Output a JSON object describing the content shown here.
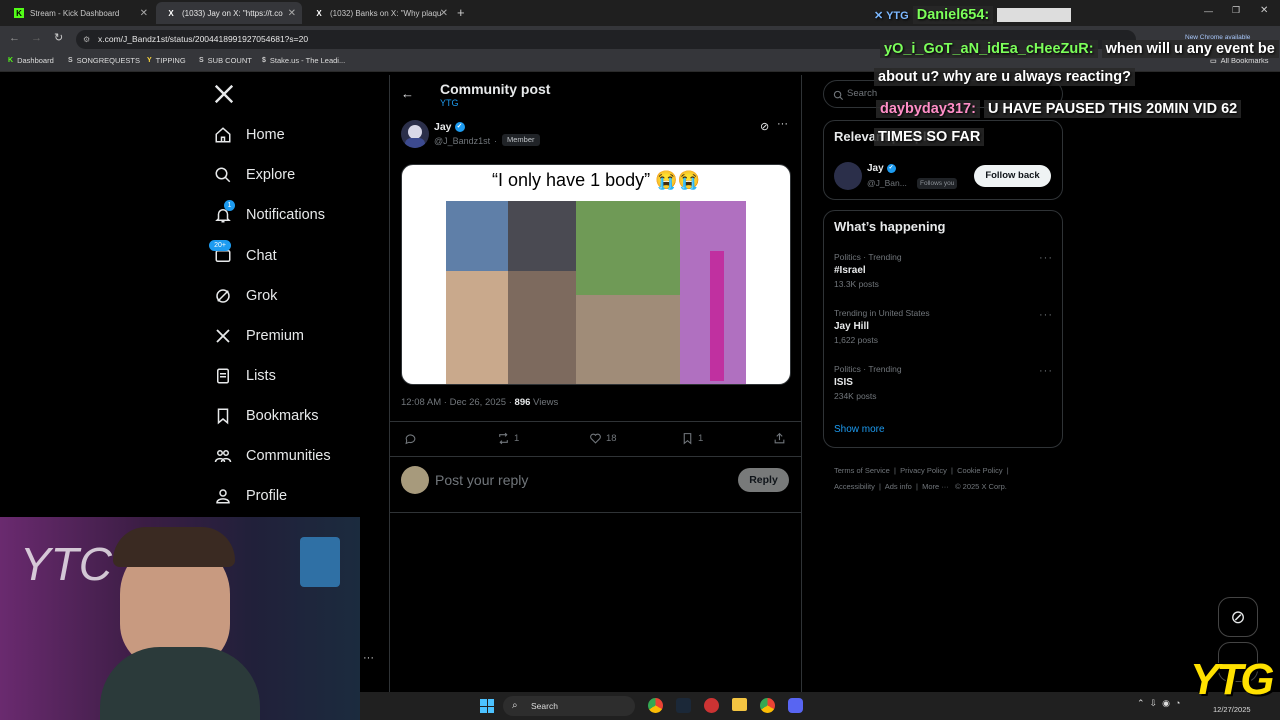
{
  "browser": {
    "tabs": [
      {
        "label": "Stream - Kick Dashboard"
      },
      {
        "label": "(1033) Jay on X: \"https://t.co"
      },
      {
        "label": "(1032) Banks on X: \"Why plaqu"
      }
    ],
    "url": "x.com/J_Bandz1st/status/2004418991927054681?s=20",
    "new_chrome": "New Chrome available",
    "bookmarks": [
      "Dashboard",
      "SONGREQUESTS",
      "TIPPING",
      "SUB COUNT",
      "Stake.us - The Leadi..."
    ],
    "all_bookmarks": "All Bookmarks"
  },
  "nav": {
    "items": [
      "Home",
      "Explore",
      "Notifications",
      "Chat",
      "Grok",
      "Premium",
      "Lists",
      "Bookmarks",
      "Communities",
      "Profile"
    ],
    "notif_badge": "1",
    "chat_badge": "20+"
  },
  "header": {
    "title": "Community post",
    "subtitle": "YTG"
  },
  "post": {
    "author": "Jay",
    "handle": "@J_Bandz1st",
    "member_badge": "Member",
    "image_caption": "“I only have 1 body” 😭😭",
    "time": "12:08 AM · Dec 26, 2025 · ",
    "views_count": "896",
    "views_label": " Views",
    "reposts": "1",
    "likes": "18",
    "bookmarks": "1"
  },
  "reply": {
    "placeholder": "Post your reply",
    "button": "Reply"
  },
  "right": {
    "search_placeholder": "Search",
    "relevant_title": "Relevant people",
    "person_name": "Jay",
    "person_handle": "@J_Ban...",
    "follows_you": "Follows you",
    "follow_back": "Follow back",
    "happening_title": "What’s happening",
    "trends": [
      {
        "meta": "Politics · Trending",
        "name": "#Israel",
        "posts": "13.3K posts"
      },
      {
        "meta": "Trending in United States",
        "name": "Jay Hill",
        "posts": "1,622 posts"
      },
      {
        "meta": "Politics · Trending",
        "name": "ISIS",
        "posts": "234K posts"
      }
    ],
    "show_more": "Show more",
    "footer": [
      "Terms of Service",
      "Privacy Policy",
      "Cookie Policy",
      "Accessibility",
      "Ads info",
      "More ···",
      "© 2025 X Corp."
    ]
  },
  "chat": [
    {
      "user": "Daniel654:",
      "message": "",
      "user_color": "#7cff5a"
    },
    {
      "user": "yO_i_GoT_aN_idEa_cHeeZuR:",
      "message": "when will u any event be",
      "user_color": "#7cff5a"
    },
    {
      "user": "",
      "message": "about u? why are u always reacting?",
      "user_color": "#7cff5a"
    },
    {
      "user": "daybyday317:",
      "message": "U HAVE PAUSED THIS 20MIN VID 62",
      "user_color": "#ff8ec7"
    },
    {
      "user": "",
      "message": "TIMES SO FAR",
      "user_color": "#ff8ec7"
    }
  ],
  "taskbar": {
    "search": "Search",
    "date": "12/27/2025"
  },
  "overlay_logo": "YTG"
}
